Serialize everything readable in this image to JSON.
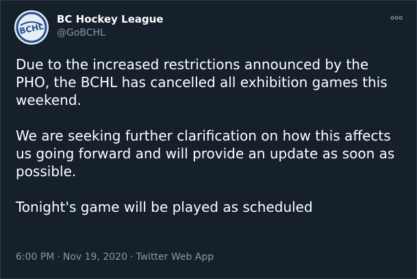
{
  "author": {
    "display_name": "BC Hockey League",
    "handle": "@GoBCHL",
    "avatar_text": "BCHL"
  },
  "tweet": {
    "paragraphs": [
      "Due to the increased restrictions announced by the\nPHO, the BCHL has cancelled all exhibition games this\nweekend.",
      "We are seeking further clarification on how this affects\nus going forward and will provide an update as soon as\npossible.",
      "Tonight's game will be played as scheduled"
    ]
  },
  "meta": {
    "time": "6:00 PM",
    "date": "Nov 19, 2020",
    "source": "Twitter Web App",
    "separator": "·"
  },
  "colors": {
    "background": "#15202b",
    "text_primary": "#ffffff",
    "text_secondary": "#8899a6",
    "logo_blue": "#1d4f91"
  },
  "icons": {
    "more": "more-options-icon"
  }
}
